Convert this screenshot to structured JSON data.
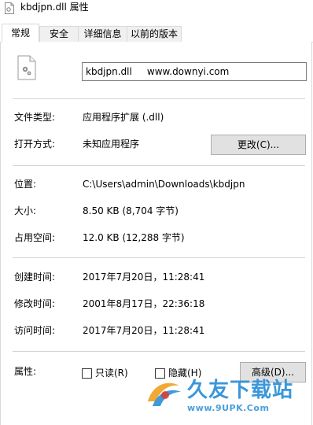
{
  "window": {
    "title": "kbdjpn.dll 属性"
  },
  "tabs": [
    {
      "label": "常规",
      "active": true
    },
    {
      "label": "安全",
      "active": false
    },
    {
      "label": "详细信息",
      "active": false
    },
    {
      "label": "以前的版本",
      "active": false
    }
  ],
  "general": {
    "file_name": "kbdjpn.dll     www.downyi.com",
    "type_label": "文件类型:",
    "type_value": "应用程序扩展 (.dll)",
    "opens_with_label": "打开方式:",
    "opens_with_value": "未知应用程序",
    "change_button": "更改(C)...",
    "location_label": "位置:",
    "location_value": "C:\\Users\\admin\\Downloads\\kbdjpn",
    "size_label": "大小:",
    "size_value": "8.50 KB (8,704 字节)",
    "size_on_disk_label": "占用空间:",
    "size_on_disk_value": "12.0 KB (12,288 字节)",
    "created_label": "创建时间:",
    "created_value": "2017年7月20日，11:28:41",
    "modified_label": "修改时间:",
    "modified_value": "2001年8月17日，22:36:18",
    "accessed_label": "访问时间:",
    "accessed_value": "2017年7月20日，11:28:41",
    "attributes_label": "属性:",
    "readonly_label": "只读(R)",
    "readonly_checked": false,
    "hidden_label": "隐藏(H)",
    "hidden_checked": false,
    "advanced_button": "高级(D)..."
  },
  "watermark": {
    "brand": "久友下载站",
    "url": "www.9UPK.Com"
  },
  "icons": {
    "title": "dll-file-icon",
    "file": "dll-file-gear-icon",
    "watermark": "watermark-logo-icon"
  },
  "colors": {
    "watermark_blue": "#2a8fd6",
    "tab_border": "#d9d9d9",
    "button_bg": "#e1e1e1"
  }
}
